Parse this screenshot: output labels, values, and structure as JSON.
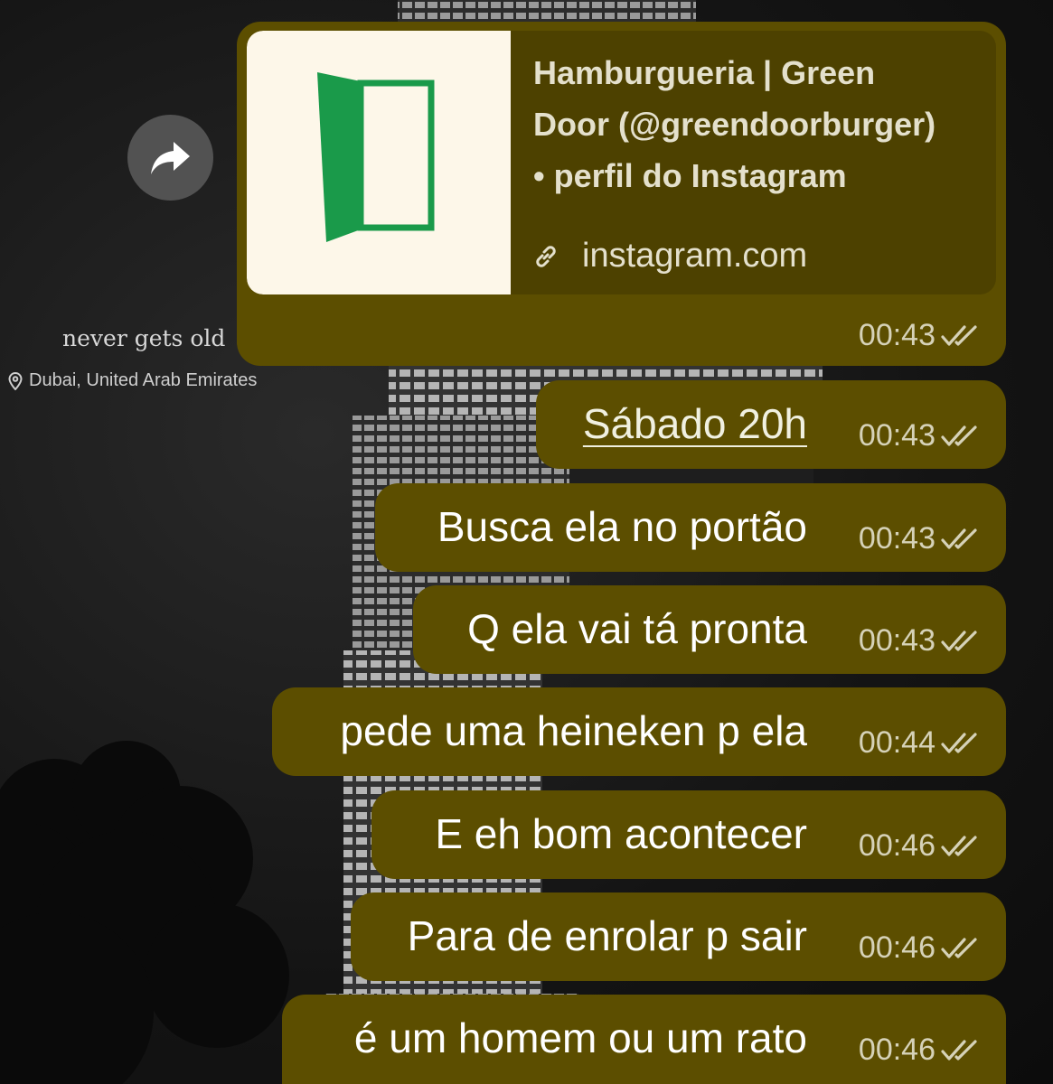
{
  "background": {
    "story_caption": "never gets old",
    "story_location": "Dubai, United Arab Emirates"
  },
  "forward_button": {
    "icon": "forward-arrow-icon"
  },
  "colors": {
    "bubble": "#5c4e00",
    "preview_card": "#4d4100",
    "door_green": "#1a9a4a"
  },
  "link_preview": {
    "title_lines": [
      "Hamburgueria | Green",
      "Door (@greendoorburger)",
      "• perfil do Instagram"
    ],
    "domain": "instagram.com",
    "time": "00:43",
    "status_icon": "double-check-icon"
  },
  "messages": [
    {
      "text": "Sábado 20h",
      "time": "00:43",
      "is_link": true
    },
    {
      "text": "Busca ela no portão",
      "time": "00:43"
    },
    {
      "text": "Q ela vai tá pronta",
      "time": "00:43"
    },
    {
      "text": "pede uma heineken p ela",
      "time": "00:44"
    },
    {
      "text": "E eh bom acontecer",
      "time": "00:46"
    },
    {
      "text": "Para de enrolar p sair",
      "time": "00:46"
    },
    {
      "text": "é um homem ou um rato",
      "time": "00:46"
    }
  ]
}
